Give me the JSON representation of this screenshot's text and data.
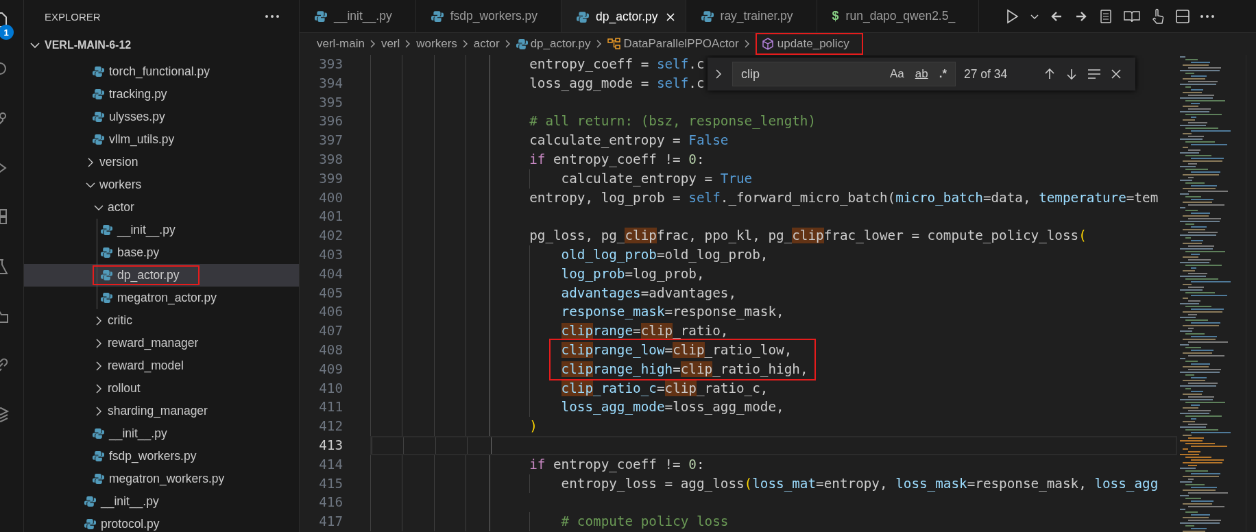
{
  "activity_bar": {
    "badge": "1"
  },
  "sidebar": {
    "title": "EXPLORER",
    "root": {
      "label": "VERL-MAIN-6-12",
      "expanded": true
    },
    "tree": [
      {
        "children": [
          {
            "children": [
              {
                "label": "torch_functional.py",
                "kind": "file",
                "selected": false,
                "boxed": false
              },
              {
                "label": "tracking.py",
                "kind": "file",
                "selected": false,
                "boxed": false
              },
              {
                "label": "ulysses.py",
                "kind": "file",
                "selected": false,
                "boxed": false
              },
              {
                "label": "vllm_utils.py",
                "kind": "file",
                "selected": false,
                "boxed": false
              }
            ]
          },
          {
            "label": "version",
            "kind": "folder",
            "expanded": false,
            "selected": false,
            "boxed": false
          },
          {
            "label": "workers",
            "kind": "folder",
            "expanded": true,
            "selected": false,
            "boxed": false,
            "children": [
              {
                "label": "actor",
                "kind": "folder",
                "expanded": true,
                "selected": false,
                "boxed": false,
                "children": [
                  {
                    "label": "__init__.py",
                    "kind": "file",
                    "selected": false,
                    "boxed": false
                  },
                  {
                    "label": "base.py",
                    "kind": "file",
                    "selected": false,
                    "boxed": false
                  },
                  {
                    "label": "dp_actor.py",
                    "kind": "file",
                    "selected": true,
                    "boxed": true
                  },
                  {
                    "label": "megatron_actor.py",
                    "kind": "file",
                    "selected": false,
                    "boxed": false
                  }
                ]
              },
              {
                "label": "critic",
                "kind": "folder",
                "expanded": false,
                "selected": false,
                "boxed": false
              },
              {
                "label": "reward_manager",
                "kind": "folder",
                "expanded": false,
                "selected": false,
                "boxed": false
              },
              {
                "label": "reward_model",
                "kind": "folder",
                "expanded": false,
                "selected": false,
                "boxed": false
              },
              {
                "label": "rollout",
                "kind": "folder",
                "expanded": false,
                "selected": false,
                "boxed": false
              },
              {
                "label": "sharding_manager",
                "kind": "folder",
                "expanded": false,
                "selected": false,
                "boxed": false
              },
              {
                "label": "__init__.py",
                "kind": "file",
                "selected": false,
                "boxed": false
              },
              {
                "label": "fsdp_workers.py",
                "kind": "file",
                "selected": false,
                "boxed": false
              },
              {
                "label": "megatron_workers.py",
                "kind": "file",
                "selected": false,
                "boxed": false
              }
            ]
          },
          {
            "label": "__init__.py",
            "kind": "file",
            "selected": false,
            "boxed": false
          },
          {
            "label": "protocol.py",
            "kind": "file",
            "selected": false,
            "boxed": false
          }
        ]
      }
    ]
  },
  "tabs": [
    {
      "label": "__init__.py",
      "kind": "python",
      "selected": false
    },
    {
      "label": "fsdp_workers.py",
      "kind": "python",
      "selected": false
    },
    {
      "label": "dp_actor.py",
      "kind": "python",
      "selected": true
    },
    {
      "label": "ray_trainer.py",
      "kind": "python",
      "selected": false
    },
    {
      "label": "run_dapo_qwen2.5_",
      "kind": "shell",
      "glyph": "$",
      "selected": false
    }
  ],
  "breadcrumb": [
    {
      "label": "verl-main",
      "kind": "folder",
      "boxed": false
    },
    {
      "label": "verl",
      "kind": "folder",
      "boxed": false
    },
    {
      "label": "workers",
      "kind": "folder",
      "boxed": false
    },
    {
      "label": "actor",
      "kind": "folder",
      "boxed": false
    },
    {
      "label": "dp_actor.py",
      "kind": "python",
      "boxed": false
    },
    {
      "label": "DataParallelPPOActor",
      "kind": "class",
      "boxed": false
    },
    {
      "label": "update_policy",
      "kind": "method",
      "boxed": true
    }
  ],
  "find": {
    "expanded": false,
    "value": "clip",
    "options": [
      {
        "label": "Aa",
        "kind": "case",
        "on": false
      },
      {
        "label": "ab",
        "kind": "word",
        "on": false
      },
      {
        "label": ".*",
        "kind": "regex",
        "on": false
      }
    ],
    "result": "27 of 34"
  },
  "lines": [
    {
      "number": "393",
      "current": false,
      "boxed": false,
      "tokens": [
        {
          "text": "                    entropy_coeff = ",
          "kind": "text"
        },
        {
          "text": "self",
          "kind": "constant"
        },
        {
          "text": ".c",
          "kind": "text"
        }
      ]
    },
    {
      "number": "394",
      "current": false,
      "boxed": false,
      "tokens": [
        {
          "text": "                    loss_agg_mode = ",
          "kind": "text"
        },
        {
          "text": "self",
          "kind": "constant"
        },
        {
          "text": ".c",
          "kind": "text"
        }
      ]
    },
    {
      "number": "395",
      "current": false,
      "boxed": false
    },
    {
      "number": "396",
      "current": false,
      "boxed": false,
      "tokens": [
        {
          "text": "                    # all return: (bsz, response_length)",
          "kind": "comment"
        }
      ]
    },
    {
      "number": "397",
      "current": false,
      "boxed": false,
      "tokens": [
        {
          "text": "                    calculate_entropy = ",
          "kind": "text"
        },
        {
          "text": "False",
          "kind": "constant"
        }
      ]
    },
    {
      "number": "398",
      "current": false,
      "boxed": false,
      "tokens": [
        {
          "text": "                    if",
          "kind": "keyword"
        },
        {
          "text": " entropy_coeff != ",
          "kind": "text"
        },
        {
          "text": "0",
          "kind": "number"
        },
        {
          "text": ":",
          "kind": "text"
        }
      ]
    },
    {
      "number": "399",
      "current": false,
      "boxed": false,
      "tokens": [
        {
          "text": "                        calculate_entropy = ",
          "kind": "text"
        },
        {
          "text": "True",
          "kind": "constant"
        }
      ]
    },
    {
      "number": "400",
      "current": false,
      "boxed": false,
      "tokens": [
        {
          "text": "                    entropy, log_prob = ",
          "kind": "text"
        },
        {
          "text": "self",
          "kind": "constant"
        },
        {
          "text": "._forward_micro_batch(",
          "kind": "text"
        },
        {
          "text": "micro_batch",
          "kind": "param"
        },
        {
          "text": "=data, ",
          "kind": "text"
        },
        {
          "text": "temperature",
          "kind": "param"
        },
        {
          "text": "=tem",
          "kind": "text"
        }
      ]
    },
    {
      "number": "401",
      "current": false,
      "boxed": false
    },
    {
      "number": "402",
      "current": false,
      "boxed": false,
      "tokens": [
        {
          "text": "                    pg_loss, pg_",
          "kind": "text"
        },
        {
          "text": "clip",
          "kind": "text_match"
        },
        {
          "text": "frac, ppo_kl, pg_",
          "kind": "text"
        },
        {
          "text": "clip",
          "kind": "text_match"
        },
        {
          "text": "frac_lower = compute_policy_loss",
          "kind": "text"
        },
        {
          "text": "(",
          "kind": "bracket"
        }
      ]
    },
    {
      "number": "403",
      "current": false,
      "boxed": false,
      "tokens": [
        {
          "text": "                        old_log_prob",
          "kind": "param"
        },
        {
          "text": "=old_log_prob,",
          "kind": "text"
        }
      ]
    },
    {
      "number": "404",
      "current": false,
      "boxed": false,
      "tokens": [
        {
          "text": "                        log_prob",
          "kind": "param"
        },
        {
          "text": "=log_prob,",
          "kind": "text"
        }
      ]
    },
    {
      "number": "405",
      "current": false,
      "boxed": false,
      "tokens": [
        {
          "text": "                        advantages",
          "kind": "param"
        },
        {
          "text": "=advantages,",
          "kind": "text"
        }
      ]
    },
    {
      "number": "406",
      "current": false,
      "boxed": false,
      "tokens": [
        {
          "text": "                        response_mask",
          "kind": "param"
        },
        {
          "text": "=response_mask,",
          "kind": "text"
        }
      ]
    },
    {
      "number": "407",
      "current": false,
      "boxed": false,
      "tokens": [
        {
          "text": "                        clip",
          "kind": "param_match"
        },
        {
          "text": "range",
          "kind": "param"
        },
        {
          "text": "=",
          "kind": "text"
        },
        {
          "text": "clip",
          "kind": "text_match"
        },
        {
          "text": "_ratio,",
          "kind": "text"
        }
      ]
    },
    {
      "number": "408",
      "current": false,
      "boxed": true,
      "tokens": [
        {
          "text": "                        clip",
          "kind": "param_match"
        },
        {
          "text": "range_low",
          "kind": "param"
        },
        {
          "text": "=",
          "kind": "text"
        },
        {
          "text": "clip",
          "kind": "text_match"
        },
        {
          "text": "_ratio_low,",
          "kind": "text"
        }
      ]
    },
    {
      "number": "409",
      "current": false,
      "boxed": true,
      "tokens": [
        {
          "text": "                        clip",
          "kind": "param_match"
        },
        {
          "text": "range_high",
          "kind": "param"
        },
        {
          "text": "=",
          "kind": "text"
        },
        {
          "text": "clip",
          "kind": "text_match"
        },
        {
          "text": "_ratio_high,",
          "kind": "text"
        }
      ]
    },
    {
      "number": "410",
      "current": false,
      "boxed": false,
      "tokens": [
        {
          "text": "                        clip",
          "kind": "param_match"
        },
        {
          "text": "_ratio_c",
          "kind": "param"
        },
        {
          "text": "=",
          "kind": "text"
        },
        {
          "text": "clip",
          "kind": "text_match"
        },
        {
          "text": "_ratio_c,",
          "kind": "text"
        }
      ]
    },
    {
      "number": "411",
      "current": false,
      "boxed": false,
      "tokens": [
        {
          "text": "                        loss_agg_mode",
          "kind": "param"
        },
        {
          "text": "=loss_agg_mode,",
          "kind": "text"
        }
      ]
    },
    {
      "number": "412",
      "current": false,
      "boxed": false,
      "tokens": [
        {
          "text": "                    )",
          "kind": "bracket"
        }
      ]
    },
    {
      "number": "413",
      "current": true,
      "boxed": false
    },
    {
      "number": "414",
      "current": false,
      "boxed": false,
      "tokens": [
        {
          "text": "                    if",
          "kind": "keyword"
        },
        {
          "text": " entropy_coeff != ",
          "kind": "text"
        },
        {
          "text": "0",
          "kind": "number"
        },
        {
          "text": ":",
          "kind": "text"
        }
      ]
    },
    {
      "number": "415",
      "current": false,
      "boxed": false,
      "tokens": [
        {
          "text": "                        entropy_loss = agg_loss",
          "kind": "text"
        },
        {
          "text": "(",
          "kind": "bracket"
        },
        {
          "text": "loss_mat",
          "kind": "param"
        },
        {
          "text": "=entropy, ",
          "kind": "text"
        },
        {
          "text": "loss_mask",
          "kind": "param"
        },
        {
          "text": "=response_mask, ",
          "kind": "text"
        },
        {
          "text": "loss_agg",
          "kind": "param"
        }
      ]
    },
    {
      "number": "416",
      "current": false,
      "boxed": false
    },
    {
      "number": "417",
      "current": false,
      "boxed": false,
      "tokens": [
        {
          "text": "                        # compute policy loss",
          "kind": "comment"
        }
      ]
    }
  ]
}
